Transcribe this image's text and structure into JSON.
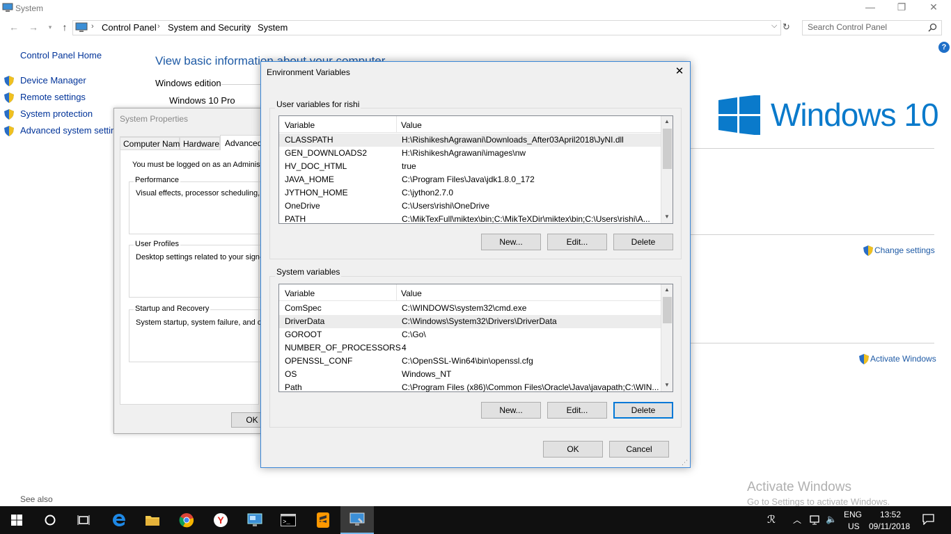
{
  "window": {
    "title": "System",
    "minimize": "—",
    "restore": "❐",
    "close": "✕"
  },
  "address": {
    "crumbs": [
      "Control Panel",
      "System and Security",
      "System"
    ],
    "search_placeholder": "Search Control Panel"
  },
  "left_pane": {
    "home": "Control Panel Home",
    "links": [
      "Device Manager",
      "Remote settings",
      "System protection",
      "Advanced system settings"
    ],
    "see_also": "See also"
  },
  "content": {
    "heading": "View basic information about your computer",
    "windows_edition": "Windows edition",
    "edition_value": "Windows 10 Pro",
    "logo_text": "Windows 10",
    "change_settings": "Change settings",
    "activate_windows_link": "Activate Windows"
  },
  "system_properties": {
    "title": "System Properties",
    "tabs": [
      "Computer Name",
      "Hardware",
      "Advanced"
    ],
    "admin_note": "You must be logged on as an Administra",
    "groups": [
      {
        "title": "Performance",
        "text": "Visual effects, processor scheduling, m"
      },
      {
        "title": "User Profiles",
        "text": "Desktop settings related to your sign-in"
      },
      {
        "title": "Startup and Recovery",
        "text": "System startup, system failure, and deb"
      }
    ],
    "ok": "OK"
  },
  "env_dialog": {
    "title": "Environment Variables",
    "close": "✕",
    "user_group": "User variables for rishi",
    "system_group": "System variables",
    "col_variable": "Variable",
    "col_value": "Value",
    "user_vars": [
      [
        "CLASSPATH",
        "H:\\RishikeshAgrawani\\Downloads_After03April2018\\JyNI.dll"
      ],
      [
        "GEN_DOWNLOADS2",
        "H:\\RishikeshAgrawani\\images\\nw"
      ],
      [
        "HV_DOC_HTML",
        "true"
      ],
      [
        "JAVA_HOME",
        "C:\\Program Files\\Java\\jdk1.8.0_172"
      ],
      [
        "JYTHON_HOME",
        "C:\\jython2.7.0"
      ],
      [
        "OneDrive",
        "C:\\Users\\rishi\\OneDrive"
      ],
      [
        "PATH",
        "C:\\MikTexFull\\miktex\\bin;C:\\MikTeXDir\\miktex\\bin;C:\\Users\\rishi\\A..."
      ]
    ],
    "system_vars": [
      [
        "ComSpec",
        "C:\\WINDOWS\\system32\\cmd.exe"
      ],
      [
        "DriverData",
        "C:\\Windows\\System32\\Drivers\\DriverData"
      ],
      [
        "GOROOT",
        "C:\\Go\\"
      ],
      [
        "NUMBER_OF_PROCESSORS",
        "4"
      ],
      [
        "OPENSSL_CONF",
        "C:\\OpenSSL-Win64\\bin\\openssl.cfg"
      ],
      [
        "OS",
        "Windows_NT"
      ],
      [
        "Path",
        "C:\\Program Files (x86)\\Common Files\\Oracle\\Java\\javapath;C:\\WIN..."
      ]
    ],
    "new": "New...",
    "edit": "Edit...",
    "delete": "Delete",
    "ok": "OK",
    "cancel": "Cancel"
  },
  "watermark": {
    "line1": "Activate Windows",
    "line2": "Go to Settings to activate Windows."
  },
  "taskbar": {
    "lang": "ENG",
    "region": "US",
    "time": "13:52",
    "date": "09/11/2018"
  },
  "colors": {
    "accent": "#0078d7",
    "link": "#003399",
    "logo": "#0a7acb"
  }
}
